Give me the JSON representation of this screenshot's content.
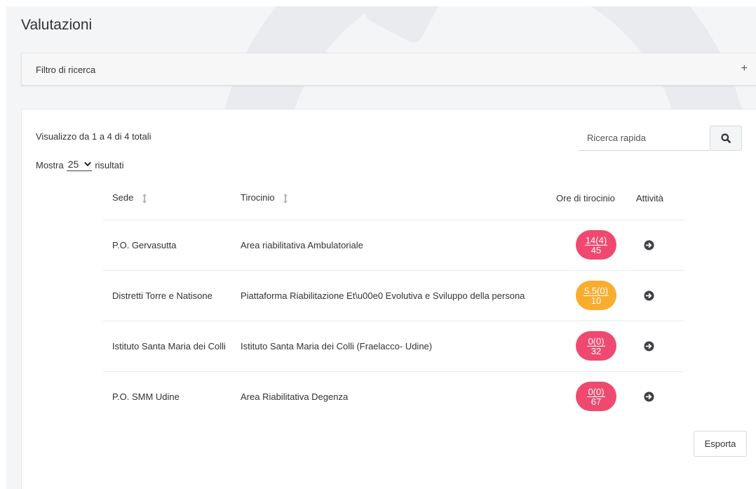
{
  "page": {
    "title": "Valutazioni"
  },
  "filter": {
    "label": "Filtro di ricerca",
    "toggle": "+"
  },
  "results": {
    "summary": "Visualizzo da 1 a 4 di 4 totali",
    "show_prefix": "Mostra",
    "page_size": "25",
    "show_suffix": "risultati"
  },
  "search": {
    "placeholder": "Ricerca rapida",
    "value": ""
  },
  "table": {
    "headers": {
      "sede": "Sede",
      "tirocinio": "Tirocinio",
      "ore": "Ore di tirocinio",
      "attivita": "Attività"
    },
    "rows": [
      {
        "sede": "P.O. Gervasutta",
        "tirocinio": "Area riabilitativa Ambulatoriale",
        "ore_done": "14(4)",
        "ore_total": "45",
        "badge_color": "#f0496f"
      },
      {
        "sede": "Distretti Torre e Natisone",
        "tirocinio": "Piattaforma Riabilitazione Et\\u00e0 Evolutiva e Sviluppo della persona",
        "ore_done": "5.5(0)",
        "ore_total": "10",
        "badge_color": "#f9ad2e"
      },
      {
        "sede": "Istituto Santa Maria dei Colli",
        "tirocinio": "Istituto Santa Maria dei Colli (Fraelacco- Udine)",
        "ore_done": "0(0)",
        "ore_total": "32",
        "badge_color": "#f0496f"
      },
      {
        "sede": "P.O. SMM Udine",
        "tirocinio": "Area Riabilitativa Degenza",
        "ore_done": "0(0)",
        "ore_total": "67",
        "badge_color": "#f0496f"
      }
    ]
  },
  "actions": {
    "export_label": "Esporta"
  },
  "icons": {
    "search": "search-icon",
    "sort": "sort-icon",
    "row_action": "arrow-circle-right-icon",
    "dropdown": "chevron-down-icon"
  }
}
